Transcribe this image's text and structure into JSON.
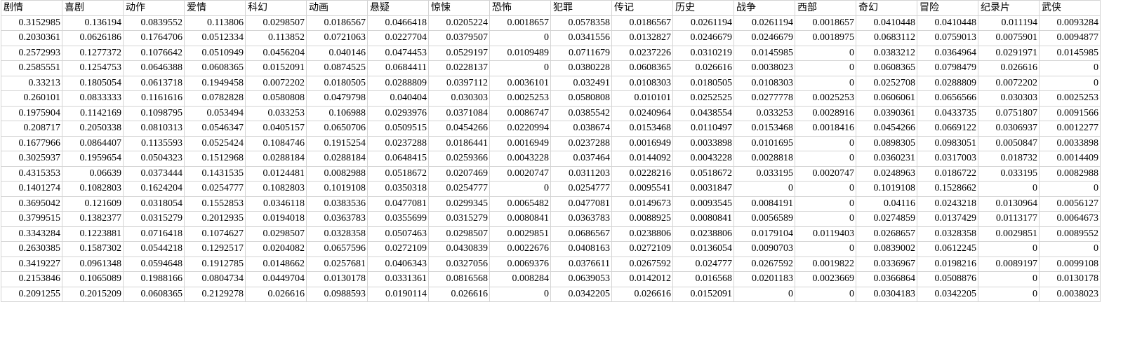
{
  "sheet": {
    "columns": [
      "剧情",
      "喜剧",
      "动作",
      "爱情",
      "科幻",
      "动画",
      "悬疑",
      "惊悚",
      "恐怖",
      "犯罪",
      "传记",
      "历史",
      "战争",
      "西部",
      "奇幻",
      "冒险",
      "纪录片",
      "武侠"
    ],
    "rows": [
      [
        "0.3152985",
        "0.136194",
        "0.0839552",
        "0.113806",
        "0.0298507",
        "0.0186567",
        "0.0466418",
        "0.0205224",
        "0.0018657",
        "0.0578358",
        "0.0186567",
        "0.0261194",
        "0.0261194",
        "0.0018657",
        "0.0410448",
        "0.0410448",
        "0.011194",
        "0.0093284"
      ],
      [
        "0.2030361",
        "0.0626186",
        "0.1764706",
        "0.0512334",
        "0.113852",
        "0.0721063",
        "0.0227704",
        "0.0379507",
        "0",
        "0.0341556",
        "0.0132827",
        "0.0246679",
        "0.0246679",
        "0.0018975",
        "0.0683112",
        "0.0759013",
        "0.0075901",
        "0.0094877"
      ],
      [
        "0.2572993",
        "0.1277372",
        "0.1076642",
        "0.0510949",
        "0.0456204",
        "0.040146",
        "0.0474453",
        "0.0529197",
        "0.0109489",
        "0.0711679",
        "0.0237226",
        "0.0310219",
        "0.0145985",
        "0",
        "0.0383212",
        "0.0364964",
        "0.0291971",
        "0.0145985"
      ],
      [
        "0.2585551",
        "0.1254753",
        "0.0646388",
        "0.0608365",
        "0.0152091",
        "0.0874525",
        "0.0684411",
        "0.0228137",
        "0",
        "0.0380228",
        "0.0608365",
        "0.026616",
        "0.0038023",
        "0",
        "0.0608365",
        "0.0798479",
        "0.026616",
        "0"
      ],
      [
        "0.33213",
        "0.1805054",
        "0.0613718",
        "0.1949458",
        "0.0072202",
        "0.0180505",
        "0.0288809",
        "0.0397112",
        "0.0036101",
        "0.032491",
        "0.0108303",
        "0.0180505",
        "0.0108303",
        "0",
        "0.0252708",
        "0.0288809",
        "0.0072202",
        "0"
      ],
      [
        "0.260101",
        "0.0833333",
        "0.1161616",
        "0.0782828",
        "0.0580808",
        "0.0479798",
        "0.040404",
        "0.030303",
        "0.0025253",
        "0.0580808",
        "0.010101",
        "0.0252525",
        "0.0277778",
        "0.0025253",
        "0.0606061",
        "0.0656566",
        "0.030303",
        "0.0025253"
      ],
      [
        "0.1975904",
        "0.1142169",
        "0.1098795",
        "0.053494",
        "0.033253",
        "0.106988",
        "0.0293976",
        "0.0371084",
        "0.0086747",
        "0.0385542",
        "0.0240964",
        "0.0438554",
        "0.033253",
        "0.0028916",
        "0.0390361",
        "0.0433735",
        "0.0751807",
        "0.0091566"
      ],
      [
        "0.208717",
        "0.2050338",
        "0.0810313",
        "0.0546347",
        "0.0405157",
        "0.0650706",
        "0.0509515",
        "0.0454266",
        "0.0220994",
        "0.038674",
        "0.0153468",
        "0.0110497",
        "0.0153468",
        "0.0018416",
        "0.0454266",
        "0.0669122",
        "0.0306937",
        "0.0012277"
      ],
      [
        "0.1677966",
        "0.0864407",
        "0.1135593",
        "0.0525424",
        "0.1084746",
        "0.1915254",
        "0.0237288",
        "0.0186441",
        "0.0016949",
        "0.0237288",
        "0.0016949",
        "0.0033898",
        "0.0101695",
        "0",
        "0.0898305",
        "0.0983051",
        "0.0050847",
        "0.0033898"
      ],
      [
        "0.3025937",
        "0.1959654",
        "0.0504323",
        "0.1512968",
        "0.0288184",
        "0.0288184",
        "0.0648415",
        "0.0259366",
        "0.0043228",
        "0.037464",
        "0.0144092",
        "0.0043228",
        "0.0028818",
        "0",
        "0.0360231",
        "0.0317003",
        "0.018732",
        "0.0014409"
      ],
      [
        "0.4315353",
        "0.06639",
        "0.0373444",
        "0.1431535",
        "0.0124481",
        "0.0082988",
        "0.0518672",
        "0.0207469",
        "0.0020747",
        "0.0311203",
        "0.0228216",
        "0.0518672",
        "0.033195",
        "0.0020747",
        "0.0248963",
        "0.0186722",
        "0.033195",
        "0.0082988"
      ],
      [
        "0.1401274",
        "0.1082803",
        "0.1624204",
        "0.0254777",
        "0.1082803",
        "0.1019108",
        "0.0350318",
        "0.0254777",
        "0",
        "0.0254777",
        "0.0095541",
        "0.0031847",
        "0",
        "0",
        "0.1019108",
        "0.1528662",
        "0",
        "0"
      ],
      [
        "0.3695042",
        "0.121609",
        "0.0318054",
        "0.1552853",
        "0.0346118",
        "0.0383536",
        "0.0477081",
        "0.0299345",
        "0.0065482",
        "0.0477081",
        "0.0149673",
        "0.0093545",
        "0.0084191",
        "0",
        "0.04116",
        "0.0243218",
        "0.0130964",
        "0.0056127"
      ],
      [
        "0.3799515",
        "0.1382377",
        "0.0315279",
        "0.2012935",
        "0.0194018",
        "0.0363783",
        "0.0355699",
        "0.0315279",
        "0.0080841",
        "0.0363783",
        "0.0088925",
        "0.0080841",
        "0.0056589",
        "0",
        "0.0274859",
        "0.0137429",
        "0.0113177",
        "0.0064673"
      ],
      [
        "0.3343284",
        "0.1223881",
        "0.0716418",
        "0.1074627",
        "0.0298507",
        "0.0328358",
        "0.0507463",
        "0.0298507",
        "0.0029851",
        "0.0686567",
        "0.0238806",
        "0.0238806",
        "0.0179104",
        "0.0119403",
        "0.0268657",
        "0.0328358",
        "0.0029851",
        "0.0089552"
      ],
      [
        "0.2630385",
        "0.1587302",
        "0.0544218",
        "0.1292517",
        "0.0204082",
        "0.0657596",
        "0.0272109",
        "0.0430839",
        "0.0022676",
        "0.0408163",
        "0.0272109",
        "0.0136054",
        "0.0090703",
        "0",
        "0.0839002",
        "0.0612245",
        "0",
        "0"
      ],
      [
        "0.3419227",
        "0.0961348",
        "0.0594648",
        "0.1912785",
        "0.0148662",
        "0.0257681",
        "0.0406343",
        "0.0327056",
        "0.0069376",
        "0.0376611",
        "0.0267592",
        "0.024777",
        "0.0267592",
        "0.0019822",
        "0.0336967",
        "0.0198216",
        "0.0089197",
        "0.0099108"
      ],
      [
        "0.2153846",
        "0.1065089",
        "0.1988166",
        "0.0804734",
        "0.0449704",
        "0.0130178",
        "0.0331361",
        "0.0816568",
        "0.008284",
        "0.0639053",
        "0.0142012",
        "0.016568",
        "0.0201183",
        "0.0023669",
        "0.0366864",
        "0.0508876",
        "0",
        "0.0130178"
      ],
      [
        "0.2091255",
        "0.2015209",
        "0.0608365",
        "0.2129278",
        "0.026616",
        "0.0988593",
        "0.0190114",
        "0.026616",
        "0",
        "0.0342205",
        "0.026616",
        "0.0152091",
        "0",
        "0",
        "0.0304183",
        "0.0342205",
        "0",
        "0.0038023"
      ]
    ]
  }
}
